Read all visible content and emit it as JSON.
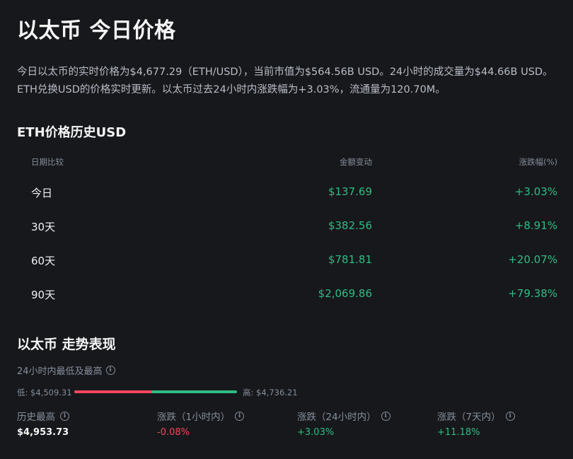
{
  "page": {
    "title": "以太币 今日价格",
    "description": "今日以太币的实时价格为$4,677.29（ETH/USD），当前市值为$564.56B USD。24小时的成交量为$44.66B USD。ETH兑换USD的价格实时更新。以太币过去24小时内涨跌幅为+3.03%，流通量为120.70M。"
  },
  "history": {
    "title": "ETH价格历史USD",
    "headers": {
      "period": "日期比较",
      "amount": "金额变动",
      "change": "涨跌幅(%)"
    },
    "rows": [
      {
        "period": "今日",
        "amount": "$137.69",
        "change": "+3.03%"
      },
      {
        "period": "30天",
        "amount": "$382.56",
        "change": "+8.91%"
      },
      {
        "period": "60天",
        "amount": "$781.81",
        "change": "+20.07%"
      },
      {
        "period": "90天",
        "amount": "$2,069.86",
        "change": "+79.38%"
      }
    ]
  },
  "performance": {
    "title": "以太币 走势表现",
    "range_caption": "24小时内最低及最高",
    "low_label": "低: $4,509.31",
    "high_label": "高: $4,736.21",
    "range_position": 0.48,
    "stats": [
      {
        "label": "历史最高",
        "value": "$4,953.73",
        "tone": "white"
      },
      {
        "label": "涨跌（1小时内）",
        "value": "-0.08%",
        "tone": "red"
      },
      {
        "label": "涨跌（24小时内）",
        "value": "+3.03%",
        "tone": "green"
      },
      {
        "label": "涨跌（7天内）",
        "value": "+11.18%",
        "tone": "green"
      }
    ]
  },
  "colors": {
    "background": "#17181b",
    "up": "#2ebd85",
    "down": "#f6465d",
    "muted": "#848e9c"
  },
  "icons": {
    "info": "info-circle-icon"
  }
}
